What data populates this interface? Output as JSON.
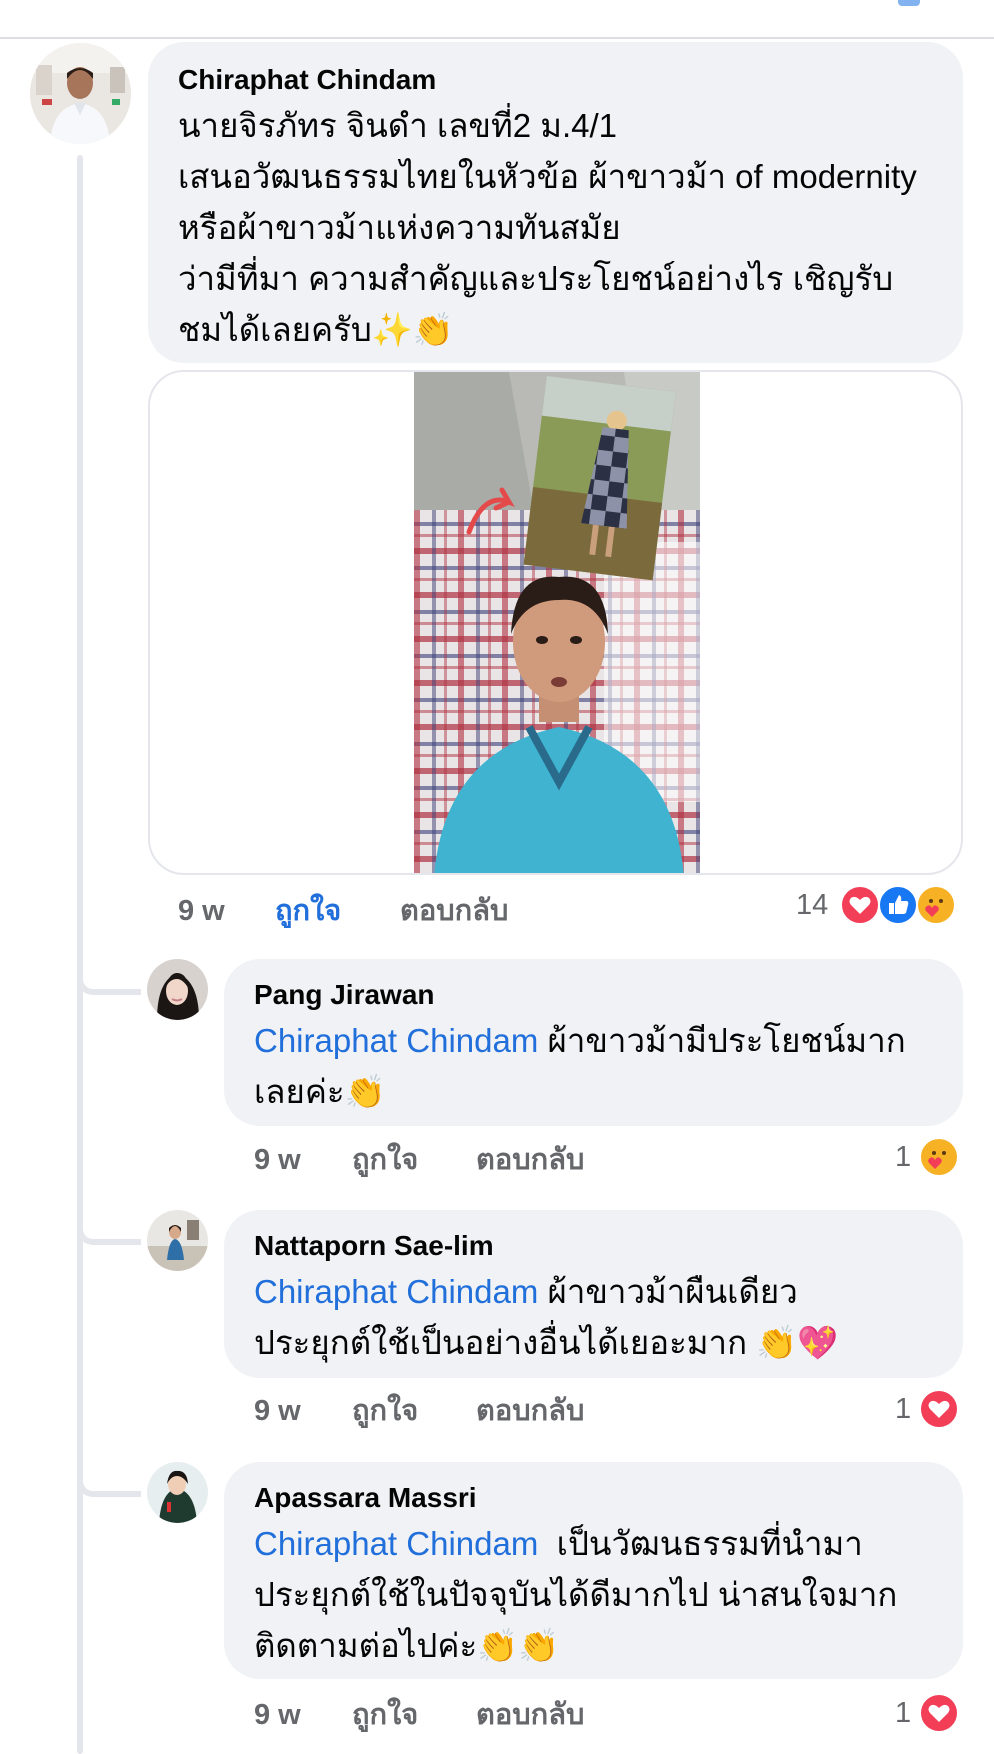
{
  "main_comment": {
    "author": "Chiraphat Chindam",
    "lines": [
      "นายจิรภัทร จินดำ เลขที่2 ม.4/1",
      "เสนอวัฒนธรรมไทยในหัวข้อ ผ้าขาวม้า of modernity",
      "หรือผ้าขาวม้าแห่งความทันสมัย",
      "ว่ามีที่มา ความสำคัญและประโยชน์อย่างไร เชิญรับ",
      "ชมได้เลยครับ✨👏"
    ],
    "time": "9 w",
    "like_label": "ถูกใจ",
    "reply_label": "ตอบกลับ",
    "reaction_count": "14",
    "reaction_icons": [
      "love-icon",
      "like-icon",
      "care-icon"
    ]
  },
  "replies": [
    {
      "author": "Pang Jirawan",
      "mention": "Chiraphat Chindam",
      "text_first": "ผ้าขาวม้ามีประโยชน์มาก",
      "text_rest": [
        "เลยค่ะ👏"
      ],
      "time": "9 w",
      "like_label": "ถูกใจ",
      "reply_label": "ตอบกลับ",
      "reaction_count": "1",
      "reaction_icons": [
        "care-icon"
      ]
    },
    {
      "author": "Nattaporn Sae-lim",
      "mention": "Chiraphat Chindam",
      "text_first": "ผ้าขาวม้าผืนเดียว",
      "text_rest": [
        "ประยุกต์ใช้เป็นอย่างอื่นได้เยอะมาก 👏💖"
      ],
      "time": "9 w",
      "like_label": "ถูกใจ",
      "reply_label": "ตอบกลับ",
      "reaction_count": "1",
      "reaction_icons": [
        "love-icon"
      ]
    },
    {
      "author": "Apassara Massri",
      "mention": "Chiraphat Chindam",
      "text_first": " เป็นวัฒนธรรมที่นำมา",
      "text_rest": [
        "ประยุกต์ใช้ในปัจจุบันได้ดีมากไป น่าสนใจมาก",
        "ติดตามต่อไปค่ะ👏👏"
      ],
      "time": "9 w",
      "like_label": "ถูกใจ",
      "reply_label": "ตอบกลับ",
      "reaction_count": "1",
      "reaction_icons": [
        "love-icon"
      ]
    }
  ],
  "colors": {
    "bubble": "#f0f2f5",
    "mention": "#216fdb",
    "liked": "#216fdb",
    "meta": "#65676b",
    "love": "#f33e58",
    "like": "#1877f2",
    "care": "#f7b125"
  }
}
